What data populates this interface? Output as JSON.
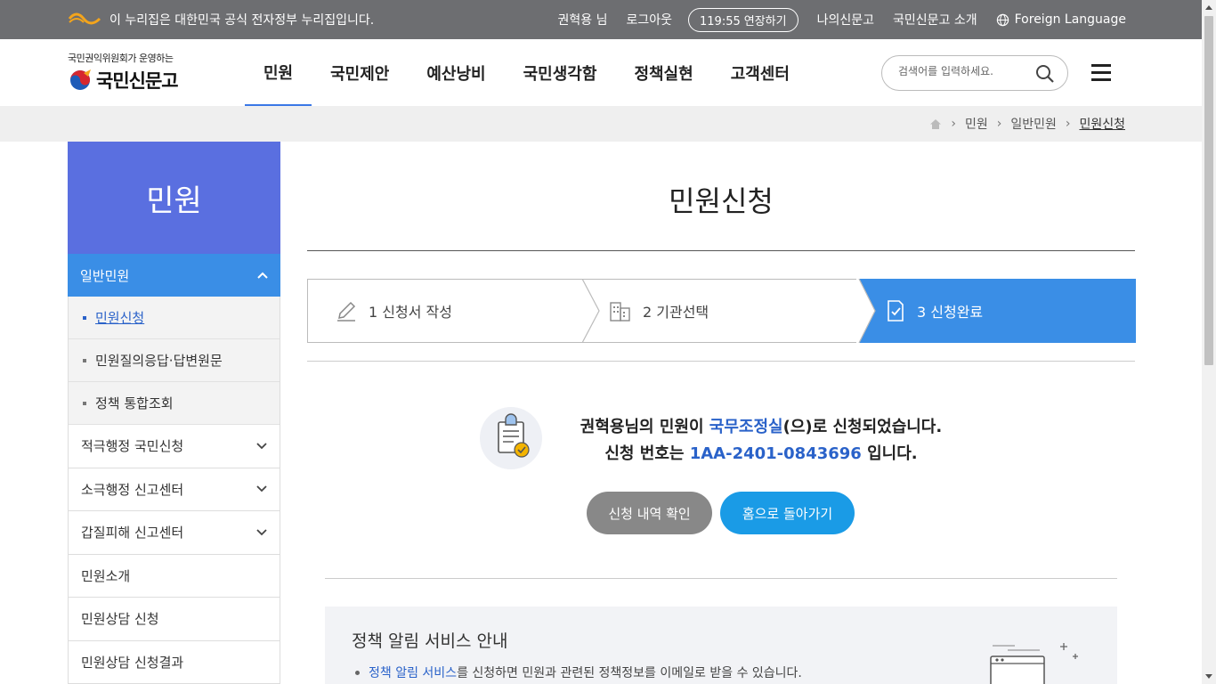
{
  "govbar": {
    "notice": "이 누리집은 대한민국 공식 전자정부 누리집입니다.",
    "user": "권혁용 님",
    "logout": "로그아웃",
    "timer": "119:55",
    "extend": "연장하기",
    "my_page": "나의신문고",
    "about": "국민신문고 소개",
    "foreign": "Foreign Language"
  },
  "header": {
    "org": "국민권익위원회가 운영하는",
    "brand": "국민신문고",
    "nav": [
      "민원",
      "국민제안",
      "예산낭비",
      "국민생각함",
      "정책실현",
      "고객센터"
    ],
    "search_placeholder": "검색어를 입력하세요."
  },
  "breadcrumb": [
    "민원",
    "일반민원",
    "민원신청"
  ],
  "sidebar": {
    "title": "민원",
    "open_section": "일반민원",
    "sub_items": [
      "민원신청",
      "민원질의응답·답변원문",
      "정책 통합조회"
    ],
    "items": [
      {
        "label": "적극행정 국민신청",
        "expandable": true
      },
      {
        "label": "소극행정 신고센터",
        "expandable": true
      },
      {
        "label": "갑질피해 신고센터",
        "expandable": true
      },
      {
        "label": "민원소개",
        "expandable": false
      },
      {
        "label": "민원상담 신청",
        "expandable": false
      },
      {
        "label": "민원상담 신청결과",
        "expandable": false
      }
    ]
  },
  "main": {
    "title": "민원신청",
    "steps": [
      "1 신청서 작성",
      "2 기관선택",
      "3 신청완료"
    ],
    "message": {
      "line1_prefix": "권혁용님의 민원이 ",
      "agency": "국무조정실",
      "line1_suffix": "(으)로 신청되었습니다.",
      "line2_prefix": "신청 번호는 ",
      "number": "1AA-2401-0843696",
      "line2_suffix": " 입니다."
    },
    "buttons": {
      "check": "신청 내역 확인",
      "home": "홈으로 돌아가기"
    },
    "notice": {
      "title": "정책 알림 서비스 안내",
      "link": "정책 알림 서비스",
      "desc": "를 신청하면 민원과 관련된 정책정보를 이메일로 받을 수 있습니다."
    }
  },
  "colors": {
    "accent": "#3a8ee6",
    "sidebar_title": "#5a6fe0",
    "link": "#2a62c9",
    "gov_bar": "#6d6e71"
  }
}
